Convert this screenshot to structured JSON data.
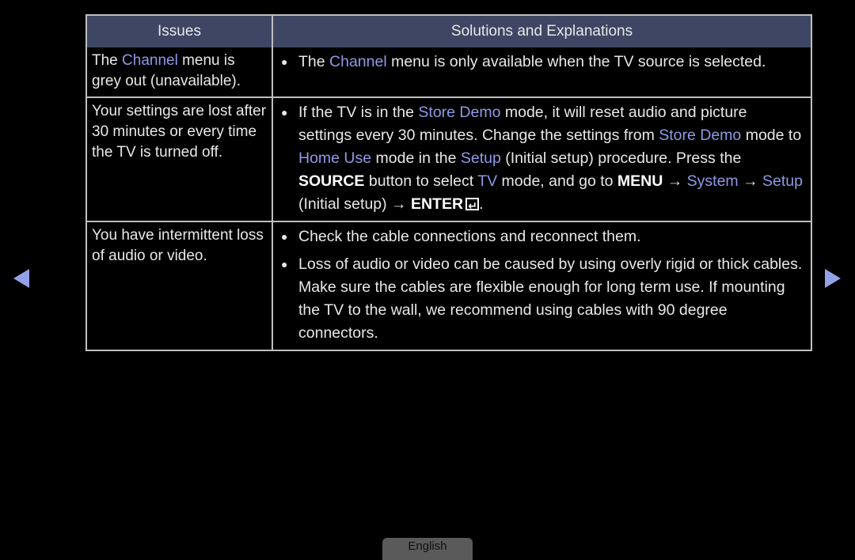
{
  "table": {
    "headers": [
      "Issues",
      "Solutions and Explanations"
    ],
    "rows": [
      {
        "issue": [
          {
            "t": "The ",
            "s": "n"
          },
          {
            "t": "Channel",
            "s": "hl"
          },
          {
            "t": " menu is grey out (unavailable).",
            "s": "n"
          }
        ],
        "solutions": [
          [
            {
              "t": "The ",
              "s": "n"
            },
            {
              "t": "Channel",
              "s": "hl"
            },
            {
              "t": " menu is only available when the TV source is selected.",
              "s": "n"
            }
          ]
        ]
      },
      {
        "issue": [
          {
            "t": "Your settings are lost after 30 minutes or every time the TV is turned off.",
            "s": "n"
          }
        ],
        "solutions": [
          [
            {
              "t": "If the TV is in the ",
              "s": "n"
            },
            {
              "t": "Store Demo",
              "s": "hl"
            },
            {
              "t": " mode, it will reset audio and picture settings every 30 minutes. Change the settings from ",
              "s": "n"
            },
            {
              "t": "Store Demo",
              "s": "hl"
            },
            {
              "t": " mode to ",
              "s": "n"
            },
            {
              "t": "Home Use",
              "s": "hl"
            },
            {
              "t": " mode in the ",
              "s": "n"
            },
            {
              "t": "Setup",
              "s": "hl"
            },
            {
              "t": " (Initial setup) procedure. Press the ",
              "s": "n"
            },
            {
              "t": "SOURCE",
              "s": "b"
            },
            {
              "t": " button to select ",
              "s": "n"
            },
            {
              "t": "TV",
              "s": "hl"
            },
            {
              "t": " mode, and go to ",
              "s": "n"
            },
            {
              "t": "MENU",
              "s": "b"
            },
            {
              "t": " → ",
              "s": "n"
            },
            {
              "t": "System",
              "s": "hl"
            },
            {
              "t": " → ",
              "s": "n"
            },
            {
              "t": "Setup",
              "s": "hl"
            },
            {
              "t": " (Initial setup) → ",
              "s": "n"
            },
            {
              "t": "ENTER",
              "s": "b"
            },
            {
              "t": "",
              "s": "enter-icon"
            },
            {
              "t": ".",
              "s": "n"
            }
          ]
        ]
      },
      {
        "issue": [
          {
            "t": "You have intermittent loss of audio or video.",
            "s": "n"
          }
        ],
        "solutions": [
          [
            {
              "t": "Check the cable connections and reconnect them.",
              "s": "n"
            }
          ],
          [
            {
              "t": "Loss of audio or video can be caused by using overly rigid or thick cables. Make sure the cables are flexible enough for long term use. If mounting the TV to the wall, we recommend using cables with 90 degree connectors.",
              "s": "n"
            }
          ]
        ]
      }
    ]
  },
  "nav": {
    "prev_icon": "triangle-left-icon",
    "next_icon": "triangle-right-icon"
  },
  "language_button": "English",
  "colors": {
    "header_bg": "#3e4663",
    "highlight": "#8e9ae6",
    "arrow": "#93a1e6"
  }
}
